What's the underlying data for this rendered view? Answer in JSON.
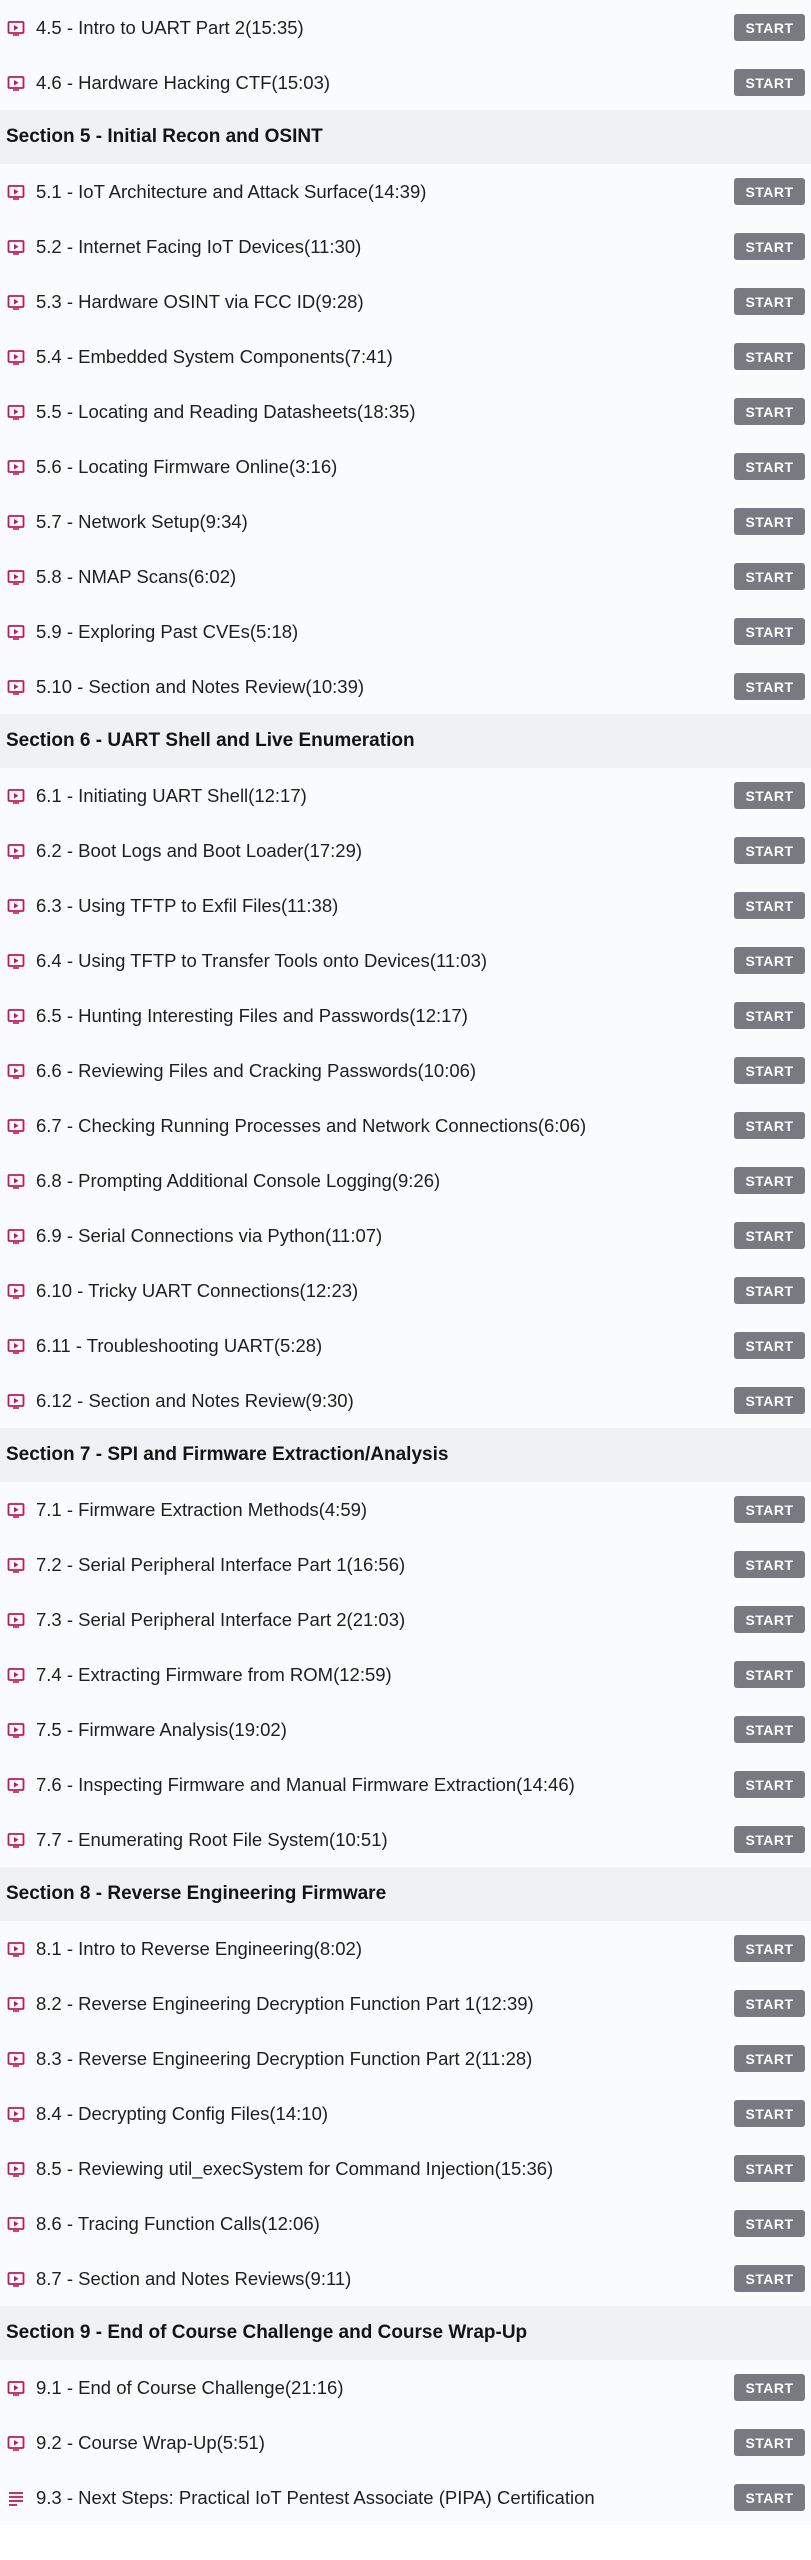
{
  "accent_color": "#c2185b",
  "button_color": "#777a80",
  "start_label": "START",
  "rows": [
    {
      "kind": "lecture",
      "icon": "video-icon",
      "title": "4.5 - Intro to UART Part 2(15:35)"
    },
    {
      "kind": "lecture",
      "icon": "video-icon",
      "title": "4.6 - Hardware Hacking CTF(15:03)"
    },
    {
      "kind": "section",
      "title": "Section 5 - Initial Recon and OSINT"
    },
    {
      "kind": "lecture",
      "icon": "video-icon",
      "title": "5.1 - IoT Architecture and Attack Surface(14:39)"
    },
    {
      "kind": "lecture",
      "icon": "video-icon",
      "title": "5.2 - Internet Facing IoT Devices(11:30)"
    },
    {
      "kind": "lecture",
      "icon": "video-icon",
      "title": "5.3 - Hardware OSINT via FCC ID(9:28)"
    },
    {
      "kind": "lecture",
      "icon": "video-icon",
      "title": "5.4 - Embedded System Components(7:41)"
    },
    {
      "kind": "lecture",
      "icon": "video-icon",
      "title": "5.5 - Locating and Reading Datasheets(18:35)"
    },
    {
      "kind": "lecture",
      "icon": "video-icon",
      "title": "5.6 - Locating Firmware Online(3:16)"
    },
    {
      "kind": "lecture",
      "icon": "video-icon",
      "title": "5.7 - Network Setup(9:34)"
    },
    {
      "kind": "lecture",
      "icon": "video-icon",
      "title": "5.8 - NMAP Scans(6:02)"
    },
    {
      "kind": "lecture",
      "icon": "video-icon",
      "title": "5.9 - Exploring Past CVEs(5:18)"
    },
    {
      "kind": "lecture",
      "icon": "video-icon",
      "title": "5.10 - Section and Notes Review(10:39)"
    },
    {
      "kind": "section",
      "title": "Section 6 - UART Shell and Live Enumeration"
    },
    {
      "kind": "lecture",
      "icon": "video-icon",
      "title": "6.1 - Initiating UART Shell(12:17)"
    },
    {
      "kind": "lecture",
      "icon": "video-icon",
      "title": "6.2 - Boot Logs and Boot Loader(17:29)"
    },
    {
      "kind": "lecture",
      "icon": "video-icon",
      "title": "6.3 - Using TFTP to Exfil Files(11:38)"
    },
    {
      "kind": "lecture",
      "icon": "video-icon",
      "title": "6.4 - Using TFTP to Transfer Tools onto Devices(11:03)"
    },
    {
      "kind": "lecture",
      "icon": "video-icon",
      "title": "6.5 - Hunting Interesting Files and Passwords(12:17)"
    },
    {
      "kind": "lecture",
      "icon": "video-icon",
      "title": "6.6 - Reviewing Files and Cracking Passwords(10:06)"
    },
    {
      "kind": "lecture",
      "icon": "video-icon",
      "title": "6.7 - Checking Running Processes and Network Connections(6:06)"
    },
    {
      "kind": "lecture",
      "icon": "video-icon",
      "title": "6.8 - Prompting Additional Console Logging(9:26)"
    },
    {
      "kind": "lecture",
      "icon": "video-icon",
      "title": "6.9 - Serial Connections via Python(11:07)"
    },
    {
      "kind": "lecture",
      "icon": "video-icon",
      "title": "6.10 - Tricky UART Connections(12:23)"
    },
    {
      "kind": "lecture",
      "icon": "video-icon",
      "title": "6.11 - Troubleshooting UART(5:28)"
    },
    {
      "kind": "lecture",
      "icon": "video-icon",
      "title": "6.12 - Section and Notes Review(9:30)"
    },
    {
      "kind": "section",
      "title": "Section 7 - SPI and Firmware Extraction/Analysis"
    },
    {
      "kind": "lecture",
      "icon": "video-icon",
      "title": "7.1 - Firmware Extraction Methods(4:59)"
    },
    {
      "kind": "lecture",
      "icon": "video-icon",
      "title": "7.2 - Serial Peripheral Interface Part 1(16:56)"
    },
    {
      "kind": "lecture",
      "icon": "video-icon",
      "title": "7.3 - Serial Peripheral Interface Part 2(21:03)"
    },
    {
      "kind": "lecture",
      "icon": "video-icon",
      "title": "7.4 - Extracting Firmware from ROM(12:59)"
    },
    {
      "kind": "lecture",
      "icon": "video-icon",
      "title": "7.5 - Firmware Analysis(19:02)"
    },
    {
      "kind": "lecture",
      "icon": "video-icon",
      "title": "7.6 - Inspecting Firmware and Manual Firmware Extraction(14:46)"
    },
    {
      "kind": "lecture",
      "icon": "video-icon",
      "title": "7.7 - Enumerating Root File System(10:51)"
    },
    {
      "kind": "section",
      "title": "Section 8 - Reverse Engineering Firmware"
    },
    {
      "kind": "lecture",
      "icon": "video-icon",
      "title": "8.1 - Intro to Reverse Engineering(8:02)"
    },
    {
      "kind": "lecture",
      "icon": "video-icon",
      "title": "8.2 - Reverse Engineering Decryption Function Part 1(12:39)"
    },
    {
      "kind": "lecture",
      "icon": "video-icon",
      "title": "8.3 - Reverse Engineering Decryption Function Part 2(11:28)"
    },
    {
      "kind": "lecture",
      "icon": "video-icon",
      "title": "8.4 - Decrypting Config Files(14:10)"
    },
    {
      "kind": "lecture",
      "icon": "video-icon",
      "title": "8.5 - Reviewing util_execSystem for Command Injection(15:36)"
    },
    {
      "kind": "lecture",
      "icon": "video-icon",
      "title": "8.6 - Tracing Function Calls(12:06)"
    },
    {
      "kind": "lecture",
      "icon": "video-icon",
      "title": "8.7 - Section and Notes Reviews(9:11)"
    },
    {
      "kind": "section",
      "title": "Section 9 - End of Course Challenge and Course Wrap-Up"
    },
    {
      "kind": "lecture",
      "icon": "video-icon",
      "title": "9.1 - End of Course Challenge(21:16)"
    },
    {
      "kind": "lecture",
      "icon": "video-icon",
      "title": "9.2 - Course Wrap-Up(5:51)"
    },
    {
      "kind": "lecture",
      "icon": "text-icon",
      "title": "9.3 - Next Steps: Practical IoT Pentest Associate (PIPA) Certification"
    }
  ]
}
